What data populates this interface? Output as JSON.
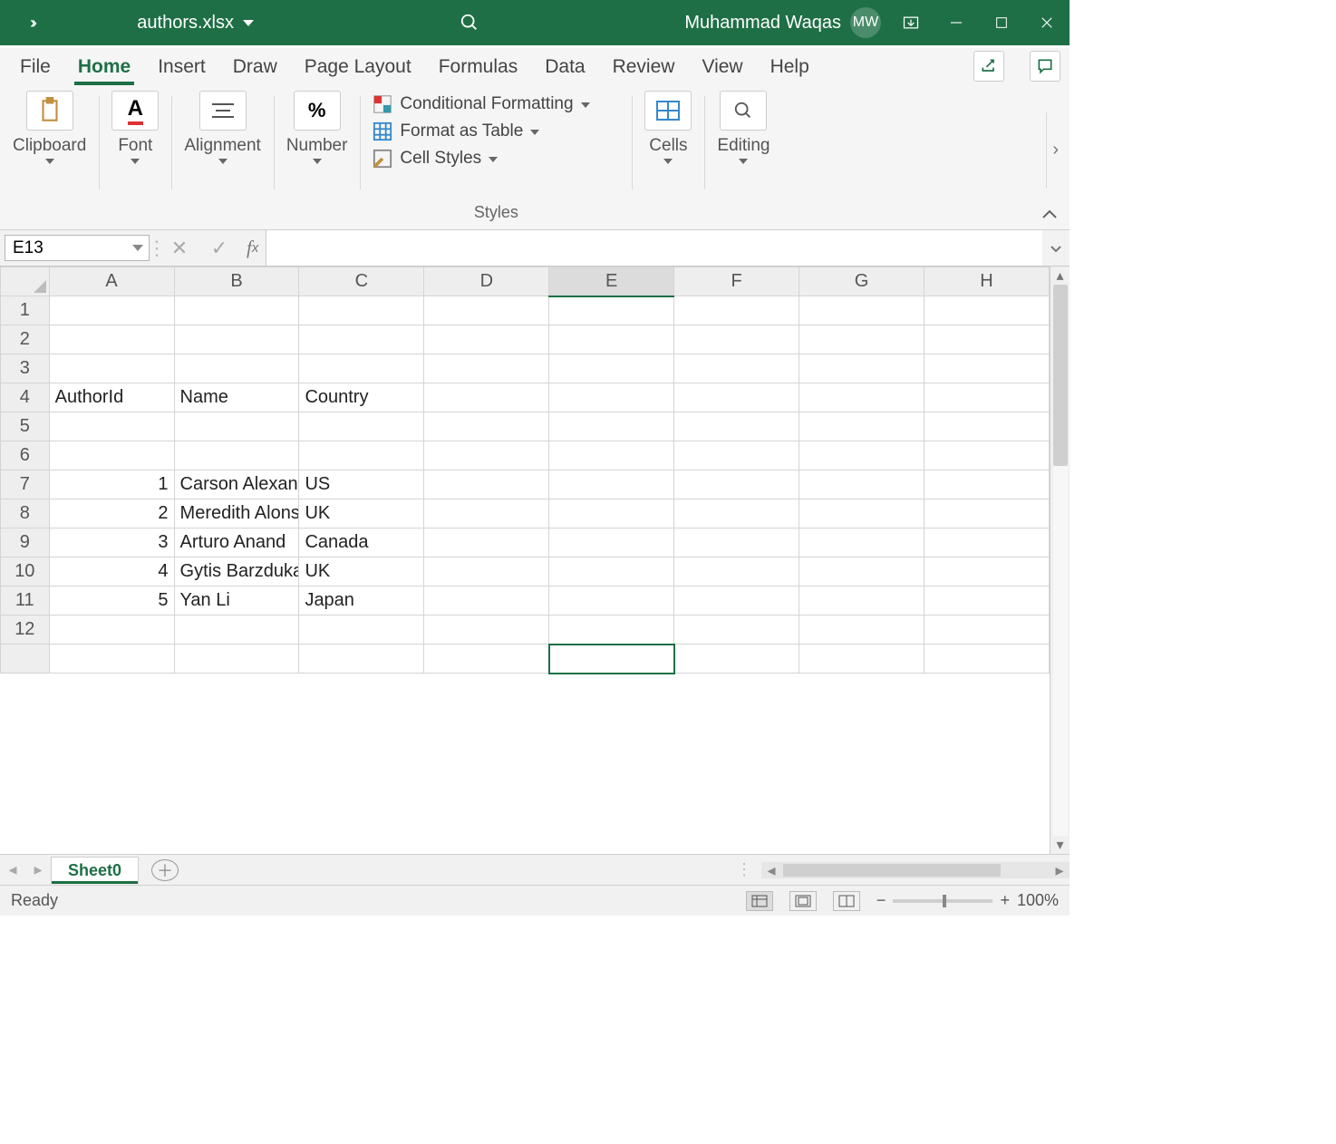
{
  "titlebar": {
    "filename": "authors.xlsx",
    "username": "Muhammad Waqas",
    "initials": "MW"
  },
  "tabs": [
    "File",
    "Home",
    "Insert",
    "Draw",
    "Page Layout",
    "Formulas",
    "Data",
    "Review",
    "View",
    "Help"
  ],
  "active_tab": "Home",
  "ribbon": {
    "clipboard": "Clipboard",
    "font": "Font",
    "alignment": "Alignment",
    "number": "Number",
    "styles": {
      "cond": "Conditional Formatting",
      "table": "Format as Table",
      "cell": "Cell Styles",
      "caption": "Styles"
    },
    "cells": "Cells",
    "editing": "Editing"
  },
  "namebox": "E13",
  "columns": [
    "A",
    "B",
    "C",
    "D",
    "E",
    "F",
    "G",
    "H"
  ],
  "rows": [
    "1",
    "2",
    "3",
    "4",
    "5",
    "6",
    "7",
    "8",
    "9",
    "10",
    "11",
    "12"
  ],
  "cells": {
    "A4": "AuthorId",
    "B4": "Name",
    "C4": "Country",
    "A7": "1",
    "B7": "Carson Alexander",
    "C7": "US",
    "A8": "2",
    "B8": "Meredith Alonso",
    "C8": "UK",
    "A9": "3",
    "B9": "Arturo Anand",
    "C9": "Canada",
    "A10": "4",
    "B10": "Gytis Barzdukas",
    "C10": "UK",
    "A11": "5",
    "B11": "Yan Li",
    "C11": "Japan"
  },
  "selected_cell": "E13",
  "sheet_name": "Sheet0",
  "status_text": "Ready",
  "zoom": "100%",
  "chart_data": {
    "type": "table",
    "title": "authors",
    "columns": [
      "AuthorId",
      "Name",
      "Country"
    ],
    "rows": [
      [
        1,
        "Carson Alexander",
        "US"
      ],
      [
        2,
        "Meredith Alonso",
        "UK"
      ],
      [
        3,
        "Arturo Anand",
        "Canada"
      ],
      [
        4,
        "Gytis Barzdukas",
        "UK"
      ],
      [
        5,
        "Yan Li",
        "Japan"
      ]
    ]
  }
}
